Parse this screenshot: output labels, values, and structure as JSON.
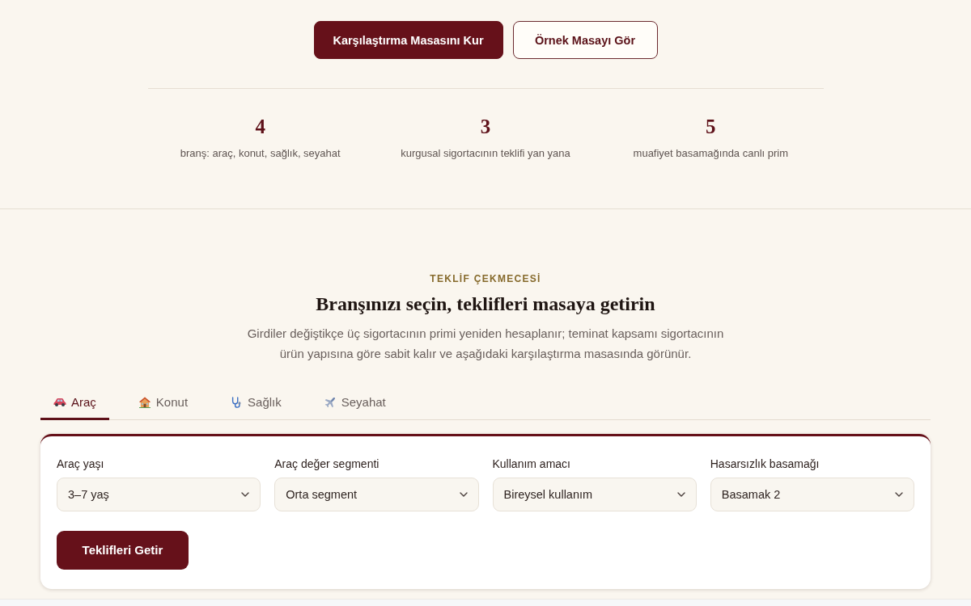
{
  "actions": [
    {
      "label": "Karşılaştırma Masasını Kur",
      "kind": "primary"
    },
    {
      "label": "Örnek Masayı Gör",
      "kind": "secondary"
    }
  ],
  "stats": [
    {
      "value": "4",
      "label": "branş: araç, konut, sağlık, seyahat"
    },
    {
      "value": "3",
      "label": "kurgusal sigortacının teklifi yan yana"
    },
    {
      "value": "5",
      "label": "muafiyet basamağında canlı prim"
    }
  ],
  "section": {
    "eyebrow": "TEKLİF ÇEKMECESİ",
    "title": "Branşınızı seçin, teklifleri masaya getirin",
    "description": "Girdiler değiştikçe üç sigortacının primi yeniden hesaplanır; teminat kapsamı sigortacının ürün yapısına göre sabit kalır ve aşağıdaki karşılaştırma masasında görünür."
  },
  "tabs": [
    {
      "label": "Araç",
      "selected": true
    },
    {
      "label": "Konut",
      "selected": false
    },
    {
      "label": "Sağlık",
      "selected": false
    },
    {
      "label": "Seyahat",
      "selected": false
    }
  ],
  "form": {
    "fields": [
      {
        "label": "Araç yaşı",
        "value": "3–7 yaş"
      },
      {
        "label": "Araç değer segmenti",
        "value": "Orta segment"
      },
      {
        "label": "Kullanım amacı",
        "value": "Bireysel kullanım"
      },
      {
        "label": "Hasarsızlık basamağı",
        "value": "Basamak 2"
      }
    ],
    "submit": "Teklifleri Getir"
  }
}
